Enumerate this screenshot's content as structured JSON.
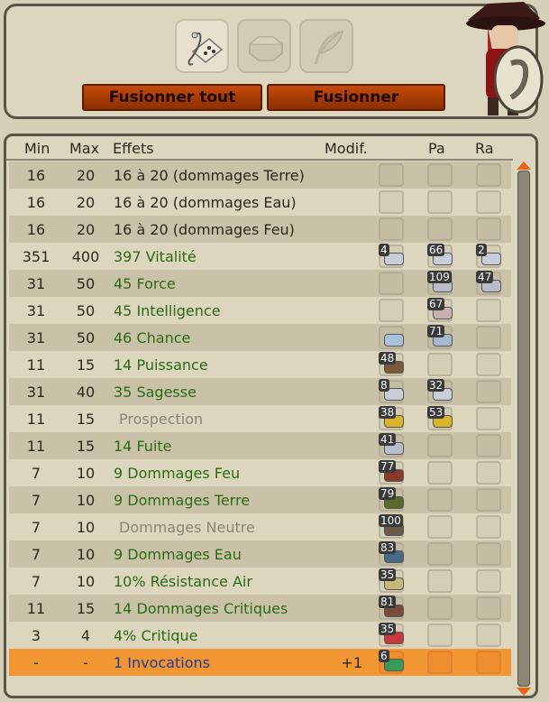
{
  "toolbar": {
    "tools": [
      {
        "icon": "rune-scroll-icon",
        "active": true
      },
      {
        "icon": "octagon-icon",
        "active": false
      },
      {
        "icon": "feather-icon",
        "active": false
      }
    ],
    "merge_all_label": "Fusionner tout",
    "merge_label": "Fusionner"
  },
  "table": {
    "headers": {
      "min": "Min",
      "max": "Max",
      "effects": "Effets",
      "modif": "Modif.",
      "pa": "Pa",
      "ra": "Ra"
    },
    "rows": [
      {
        "min": "16",
        "max": "20",
        "effect": "16 à 20 (dommages Terre)",
        "style": "plain",
        "modif": "",
        "runes": [
          null,
          null,
          null
        ]
      },
      {
        "min": "16",
        "max": "20",
        "effect": "16 à 20 (dommages Eau)",
        "style": "plain",
        "modif": "",
        "runes": [
          null,
          null,
          null
        ]
      },
      {
        "min": "16",
        "max": "20",
        "effect": "16 à 20 (dommages Feu)",
        "style": "plain",
        "modif": "",
        "runes": [
          null,
          null,
          null
        ]
      },
      {
        "min": "351",
        "max": "400",
        "effect": "397 Vitalité",
        "style": "green",
        "modif": "",
        "runes": [
          {
            "count": "4",
            "color": "#c9cdd8"
          },
          {
            "count": "66",
            "color": "#c9cdd8"
          },
          {
            "count": "2",
            "color": "#c9cdd8"
          }
        ]
      },
      {
        "min": "31",
        "max": "50",
        "effect": "45 Force",
        "style": "green",
        "modif": "",
        "runes": [
          null,
          {
            "count": "109",
            "color": "#b9bdc8"
          },
          {
            "count": "47",
            "color": "#b9bdc8"
          }
        ]
      },
      {
        "min": "31",
        "max": "50",
        "effect": "45 Intelligence",
        "style": "green",
        "modif": "",
        "runes": [
          null,
          {
            "count": "67",
            "color": "#c8b0b0"
          },
          null
        ]
      },
      {
        "min": "31",
        "max": "50",
        "effect": "46 Chance",
        "style": "green",
        "modif": "",
        "runes": [
          {
            "count": "",
            "color": "#a9c3dc"
          },
          {
            "count": "71",
            "color": "#a9b8cc"
          },
          null
        ]
      },
      {
        "min": "11",
        "max": "15",
        "effect": "14 Puissance",
        "style": "green",
        "modif": "",
        "runes": [
          {
            "count": "48",
            "color": "#7a5a3a"
          },
          null,
          null
        ]
      },
      {
        "min": "31",
        "max": "40",
        "effect": "35 Sagesse",
        "style": "green",
        "modif": "",
        "runes": [
          {
            "count": "8",
            "color": "#c9cdd8"
          },
          {
            "count": "32",
            "color": "#c9cdd8"
          },
          null
        ]
      },
      {
        "min": "11",
        "max": "15",
        "effect": "Prospection",
        "style": "grey",
        "modif": "",
        "runes": [
          {
            "count": "38",
            "color": "#d8b52a"
          },
          {
            "count": "53",
            "color": "#d8b52a"
          },
          null
        ]
      },
      {
        "min": "11",
        "max": "15",
        "effect": "14 Fuite",
        "style": "green",
        "modif": "",
        "runes": [
          {
            "count": "41",
            "color": "#b9bdc8"
          },
          null,
          null
        ]
      },
      {
        "min": "7",
        "max": "10",
        "effect": "9 Dommages Feu",
        "style": "green",
        "modif": "",
        "runes": [
          {
            "count": "77",
            "color": "#8a3a2a"
          },
          null,
          null
        ]
      },
      {
        "min": "7",
        "max": "10",
        "effect": "9 Dommages Terre",
        "style": "green",
        "modif": "",
        "runes": [
          {
            "count": "79",
            "color": "#5a6a2a"
          },
          null,
          null
        ]
      },
      {
        "min": "7",
        "max": "10",
        "effect": "Dommages Neutre",
        "style": "grey",
        "modif": "",
        "runes": [
          {
            "count": "100",
            "color": "#6a5a4a"
          },
          null,
          null
        ]
      },
      {
        "min": "7",
        "max": "10",
        "effect": "9 Dommages Eau",
        "style": "green",
        "modif": "",
        "runes": [
          {
            "count": "83",
            "color": "#4a6a8a"
          },
          null,
          null
        ]
      },
      {
        "min": "7",
        "max": "10",
        "effect": "10% Résistance Air",
        "style": "green",
        "modif": "",
        "runes": [
          {
            "count": "35",
            "color": "#c8b878"
          },
          null,
          null
        ]
      },
      {
        "min": "11",
        "max": "15",
        "effect": "14 Dommages Critiques",
        "style": "green",
        "modif": "",
        "runes": [
          {
            "count": "81",
            "color": "#7a4a3a"
          },
          null,
          null
        ]
      },
      {
        "min": "3",
        "max": "4",
        "effect": "4% Critique",
        "style": "green",
        "modif": "",
        "runes": [
          {
            "count": "35",
            "color": "#c83a3a"
          },
          null,
          null
        ]
      },
      {
        "min": "-",
        "max": "-",
        "effect": "1 Invocations",
        "style": "blue",
        "modif": "+1",
        "runes": [
          {
            "count": "6",
            "color": "#3a9a5a"
          },
          null,
          null
        ],
        "selected": true
      }
    ]
  }
}
